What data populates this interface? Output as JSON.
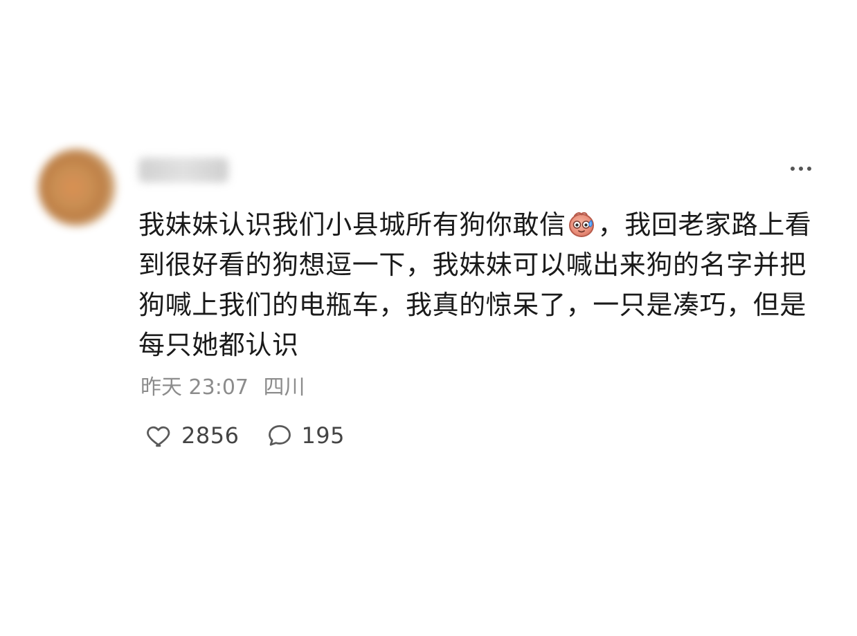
{
  "post": {
    "username": "",
    "text_before_emoji": "我妹妹认识我们小县城所有狗你敢信",
    "emoji_name": "sweat-face-emoji",
    "text_after_emoji": "，我回老家路上看到很好看的狗想逗一下，我妹妹可以喊出来狗的名字并把狗喊上我们的电瓶车，我真的惊呆了，一只是凑巧，但是每只她都认识",
    "time": "昨天 23:07",
    "location": "四川"
  },
  "actions": {
    "likes": "2856",
    "comments": "195"
  },
  "icons": {
    "like": "heart-outline-icon",
    "comment": "speech-bubble-icon",
    "more": "more-dots-icon"
  }
}
